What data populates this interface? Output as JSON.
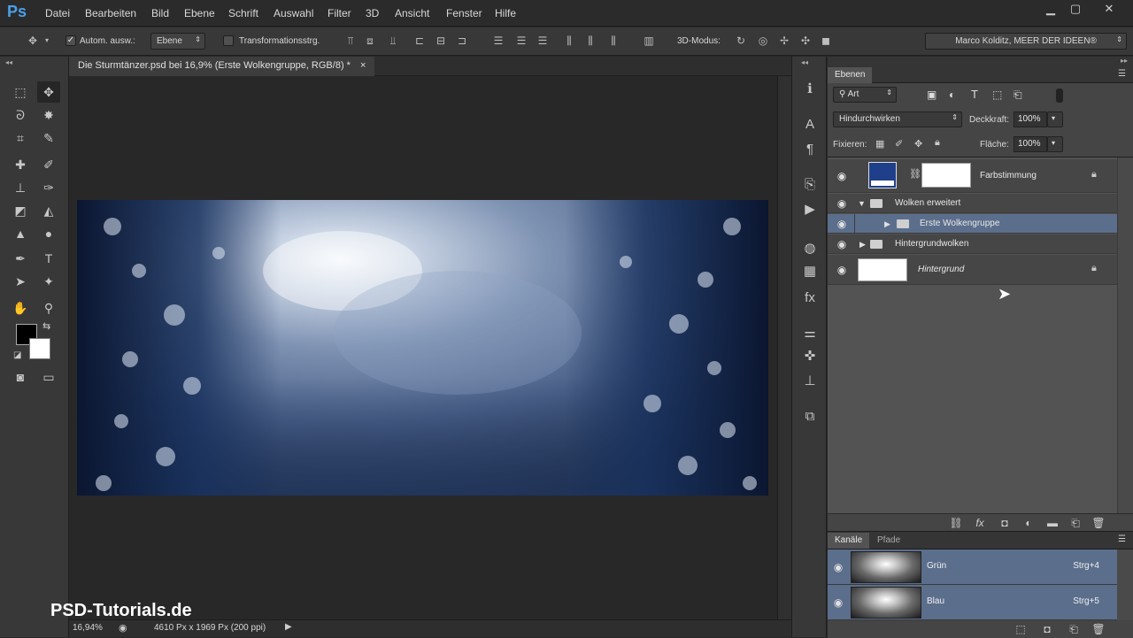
{
  "app": {
    "logo": "Ps"
  },
  "menu": [
    "Datei",
    "Bearbeiten",
    "Bild",
    "Ebene",
    "Schrift",
    "Auswahl",
    "Filter",
    "3D",
    "Ansicht",
    "Fenster",
    "Hilfe"
  ],
  "window_controls": {
    "minimize": "▁",
    "maximize": "▢",
    "close": "✕"
  },
  "options": {
    "auto_select_label": "Autom. ausw.:",
    "auto_select_checked": true,
    "auto_select_value": "Ebene",
    "transform_label": "Transformationsstrg.",
    "transform_checked": false,
    "mode_3d_label": "3D-Modus:",
    "workspace": "Marco Kolditz, MEER DER IDEEN®"
  },
  "document": {
    "tab_title": "Die Sturmtänzer.psd bei 16,9% (Erste Wolkengruppe, RGB/8) *",
    "tab_close": "×",
    "zoom": "16,94%",
    "doc_info": "4610 Px x 1969 Px (200 ppi)"
  },
  "layers_panel": {
    "tab": "Ebenen",
    "filter_kind": "Art",
    "blend_mode": "Hindurchwirken",
    "opacity_label": "Deckkraft:",
    "opacity_value": "100%",
    "lock_label": "Fixieren:",
    "fill_label": "Fläche:",
    "fill_value": "100%",
    "layers": [
      {
        "name": "Farbstimmung",
        "type": "adjustment",
        "visible": true,
        "locked": true,
        "thumb_color": "#1f3f8a"
      },
      {
        "name": "Wolken erweitert",
        "type": "group",
        "visible": true,
        "expanded": true
      },
      {
        "name": "Erste Wolkengruppe",
        "type": "group",
        "visible": true,
        "expanded": false,
        "selected": true
      },
      {
        "name": "Hintergrundwolken",
        "type": "group",
        "visible": true,
        "expanded": false
      },
      {
        "name": "Hintergrund",
        "type": "background",
        "visible": true,
        "locked": true
      }
    ]
  },
  "channels_panel": {
    "tabs": [
      "Kanäle",
      "Pfade"
    ],
    "channels": [
      {
        "name": "Grün",
        "shortcut": "Strg+4"
      },
      {
        "name": "Blau",
        "shortcut": "Strg+5"
      }
    ]
  },
  "watermark": "PSD-Tutorials.de",
  "colors": {
    "accent": "#4aa0e8",
    "selection": "#5b6e8c"
  }
}
